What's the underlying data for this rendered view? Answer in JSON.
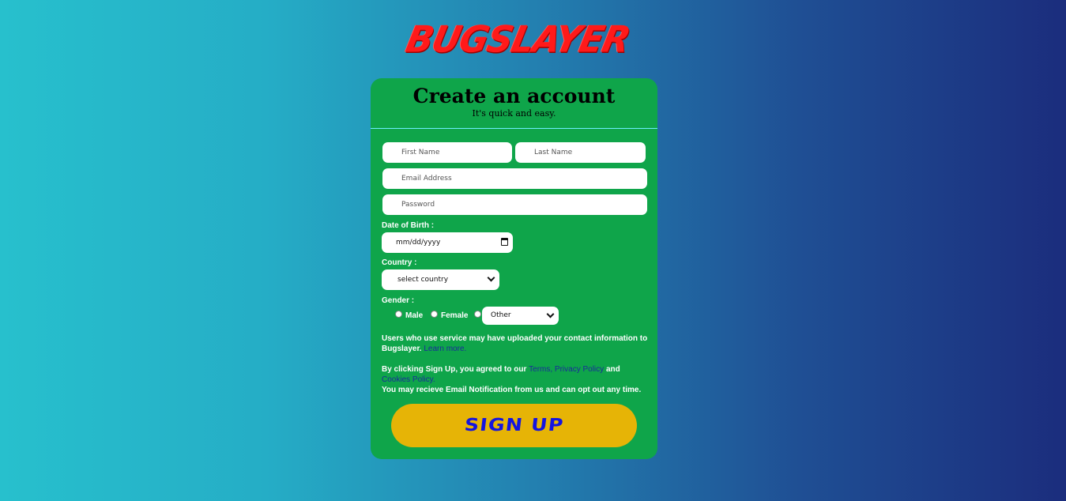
{
  "brand": {
    "logo_text": "BUGSLAYER"
  },
  "form": {
    "title": "Create an account",
    "subtitle": "It's quick and easy.",
    "first_name_placeholder": "First Name",
    "last_name_placeholder": "Last Name",
    "email_placeholder": "Email Address",
    "password_placeholder": "Password",
    "dob_label": "Date of Birth :",
    "dob_value": "mm/dd/yyyy",
    "country_label": "Country :",
    "country_value": "select country",
    "gender_label": "Gender :",
    "gender_options": [
      "Male",
      "Female"
    ],
    "gender_other_value": "Other",
    "notice1_text": "Users who use service may have uploaded your contact information to Bugslayer.",
    "notice1_link": "Learn more.",
    "terms_prefix": "By clicking Sign Up, you agreed to our",
    "terms_link": "Terms,",
    "privacy_link": "Privacy Policy",
    "terms_and": "and",
    "cookies_link": "Cookies Policy.",
    "notification_text": "You may recieve Email Notification from us and can opt out any time.",
    "signup_label": "SIGN UP"
  },
  "colors": {
    "card": "#0fa54a",
    "button": "#e6b406",
    "button_text": "#1414e0",
    "logo": "#ff1a1a",
    "link": "#1a2b9a"
  }
}
